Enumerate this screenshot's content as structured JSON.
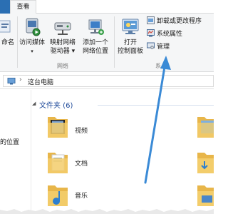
{
  "tabs": {
    "view": "查看"
  },
  "ribbon": {
    "cut_label_fragment": "命名",
    "access_media": "访问媒体",
    "map_drive_line1": "映射网络",
    "map_drive_line2": "驱动器",
    "add_location_line1": "添加一个",
    "add_location_line2": "网络位置",
    "network_group": "网络",
    "open_cp_line1": "打开",
    "open_cp_line2": "控制面板",
    "uninstall": "卸载或更改程序",
    "system_props": "系统属性",
    "manage": "管理",
    "system_group_fragment": "系"
  },
  "address": {
    "location": "这台电脑"
  },
  "nav": {
    "item_fragment": "的位置"
  },
  "content": {
    "folders_header": "文件夹 (6)",
    "folders": [
      {
        "label": "视频",
        "icon": "video-folder-icon"
      },
      {
        "label": "文档",
        "icon": "documents-folder-icon"
      },
      {
        "label": "音乐",
        "icon": "music-folder-icon"
      }
    ]
  },
  "colors": {
    "accent_blue": "#2b6fb3",
    "arrow_blue": "#3a8ad6",
    "folder_yellow": "#f3cd6b",
    "header_blue": "#1e4a9a"
  }
}
